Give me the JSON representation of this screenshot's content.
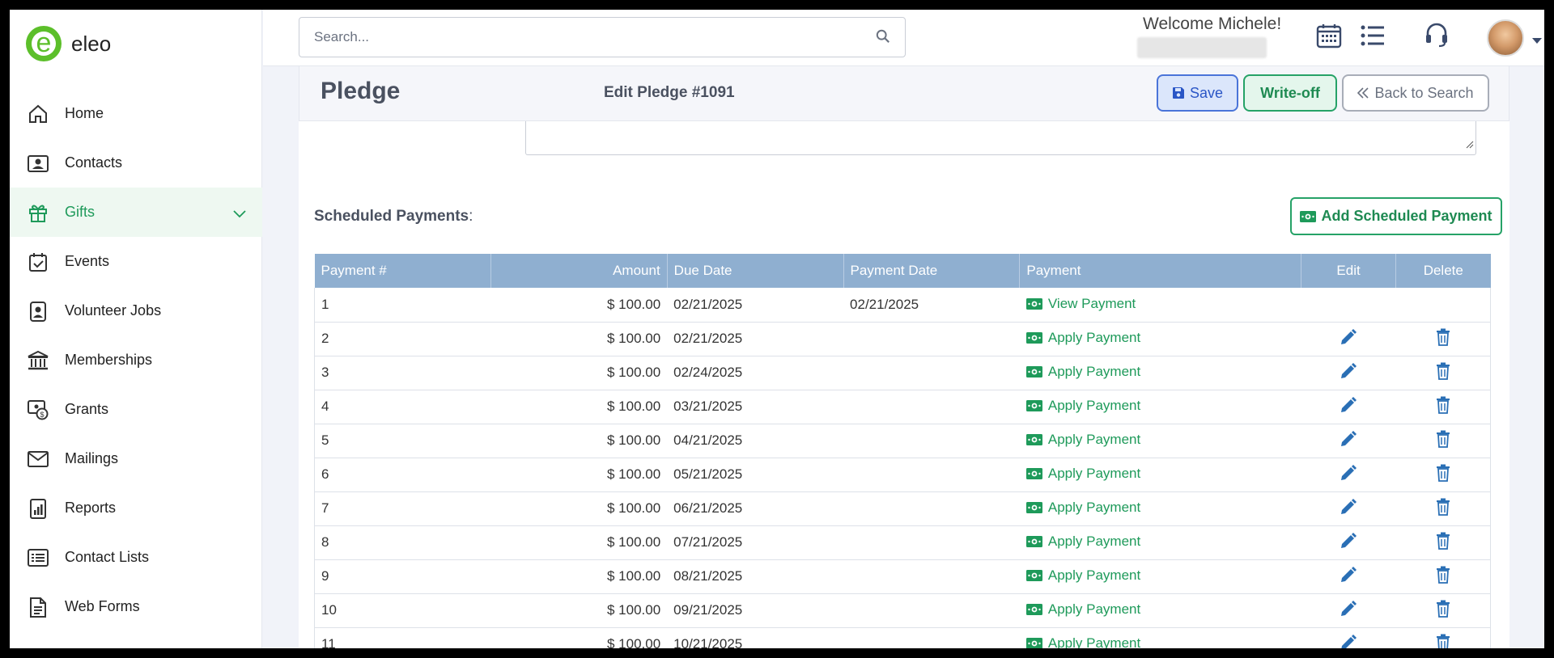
{
  "app": {
    "logo_letter": "e",
    "name": "eleo"
  },
  "sidebar": {
    "items": [
      {
        "label": "Home",
        "icon": "home-icon"
      },
      {
        "label": "Contacts",
        "icon": "contacts-icon"
      },
      {
        "label": "Gifts",
        "icon": "gift-icon",
        "active": true
      },
      {
        "label": "Events",
        "icon": "calendar-check-icon"
      },
      {
        "label": "Volunteer Jobs",
        "icon": "volunteer-badge-icon"
      },
      {
        "label": "Memberships",
        "icon": "bank-icon"
      },
      {
        "label": "Grants",
        "icon": "grant-icon"
      },
      {
        "label": "Mailings",
        "icon": "envelope-icon"
      },
      {
        "label": "Reports",
        "icon": "report-icon"
      },
      {
        "label": "Contact Lists",
        "icon": "list-icon"
      },
      {
        "label": "Web Forms",
        "icon": "form-icon"
      }
    ]
  },
  "topbar": {
    "search_placeholder": "Search...",
    "welcome": "Welcome Michele!"
  },
  "header": {
    "title": "Pledge",
    "edit_title": "Edit Pledge #1091",
    "save_label": "Save",
    "writeoff_label": "Write-off",
    "back_label": "Back to Search"
  },
  "payments": {
    "title": "Scheduled Payments",
    "colon": ":",
    "add_label": "Add Scheduled Payment",
    "columns": [
      "Payment #",
      "Amount",
      "Due Date",
      "Payment Date",
      "Payment",
      "Edit",
      "Delete"
    ],
    "rows": [
      {
        "num": "1",
        "amount": "$ 100.00",
        "due": "02/21/2025",
        "paid": "02/21/2025",
        "action": "View Payment",
        "editable": false
      },
      {
        "num": "2",
        "amount": "$ 100.00",
        "due": "02/21/2025",
        "paid": "",
        "action": "Apply Payment",
        "editable": true
      },
      {
        "num": "3",
        "amount": "$ 100.00",
        "due": "02/24/2025",
        "paid": "",
        "action": "Apply Payment",
        "editable": true
      },
      {
        "num": "4",
        "amount": "$ 100.00",
        "due": "03/21/2025",
        "paid": "",
        "action": "Apply Payment",
        "editable": true
      },
      {
        "num": "5",
        "amount": "$ 100.00",
        "due": "04/21/2025",
        "paid": "",
        "action": "Apply Payment",
        "editable": true
      },
      {
        "num": "6",
        "amount": "$ 100.00",
        "due": "05/21/2025",
        "paid": "",
        "action": "Apply Payment",
        "editable": true
      },
      {
        "num": "7",
        "amount": "$ 100.00",
        "due": "06/21/2025",
        "paid": "",
        "action": "Apply Payment",
        "editable": true
      },
      {
        "num": "8",
        "amount": "$ 100.00",
        "due": "07/21/2025",
        "paid": "",
        "action": "Apply Payment",
        "editable": true
      },
      {
        "num": "9",
        "amount": "$ 100.00",
        "due": "08/21/2025",
        "paid": "",
        "action": "Apply Payment",
        "editable": true
      },
      {
        "num": "10",
        "amount": "$ 100.00",
        "due": "09/21/2025",
        "paid": "",
        "action": "Apply Payment",
        "editable": true
      },
      {
        "num": "11",
        "amount": "$ 100.00",
        "due": "10/21/2025",
        "paid": "",
        "action": "Apply Payment",
        "editable": true
      }
    ]
  },
  "colors": {
    "accent_green": "#1e9a5a",
    "brand_green": "#5cbf2a",
    "table_header": "#8fafd0",
    "link_blue": "#2a6fb5"
  }
}
